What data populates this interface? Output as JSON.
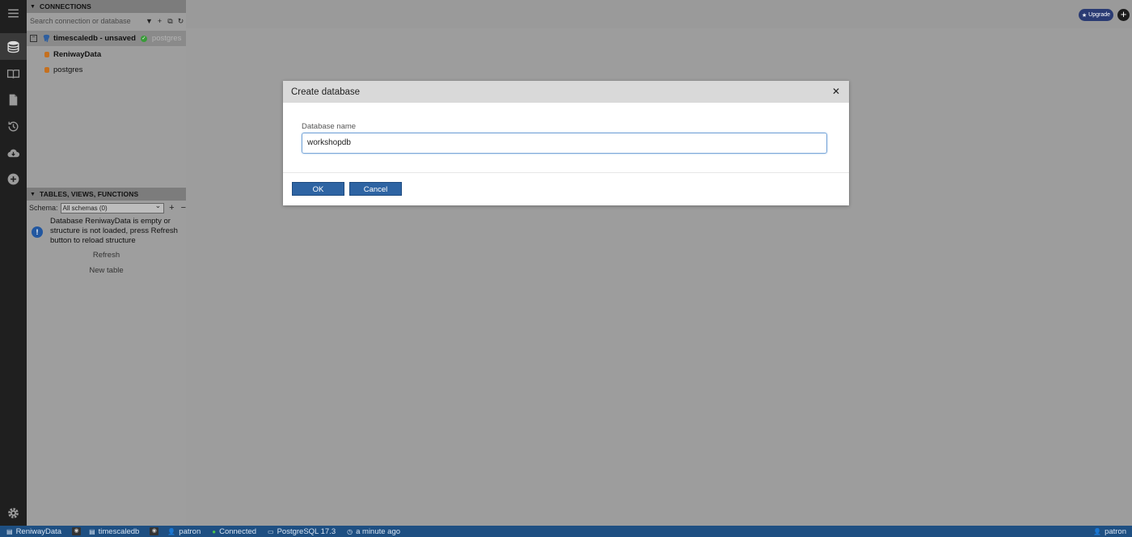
{
  "left_panel": {
    "connections_header": "CONNECTIONS",
    "search_placeholder": "Search connection or database",
    "connection": {
      "name": "timescaledb - unsaved",
      "detail": "postgres"
    },
    "databases": [
      "ReniwayData",
      "postgres"
    ],
    "tables_header": "TABLES, VIEWS, FUNCTIONS",
    "schema_label": "Schema:",
    "schema_value": "All schemas (0)",
    "info_text": "Database ReniwayData is empty or structure is not loaded, press Refresh button to reload structure",
    "refresh_link": "Refresh",
    "new_table_link": "New table"
  },
  "topbar": {
    "upgrade_label": "Upgrade"
  },
  "dialog": {
    "title": "Create database",
    "field_label": "Database name",
    "field_value": "workshopdb",
    "ok_label": "OK",
    "cancel_label": "Cancel"
  },
  "statusbar": {
    "database": "ReniwayData",
    "server": "timescaledb",
    "user": "patron",
    "status": "Connected",
    "engine": "PostgreSQL 17.3",
    "time": "a minute ago",
    "right_user": "patron"
  },
  "icons": [
    "menu-icon",
    "database-icon",
    "book-icon",
    "file-icon",
    "history-icon",
    "cloud-icon",
    "plus-circle-icon",
    "gear-icon"
  ]
}
